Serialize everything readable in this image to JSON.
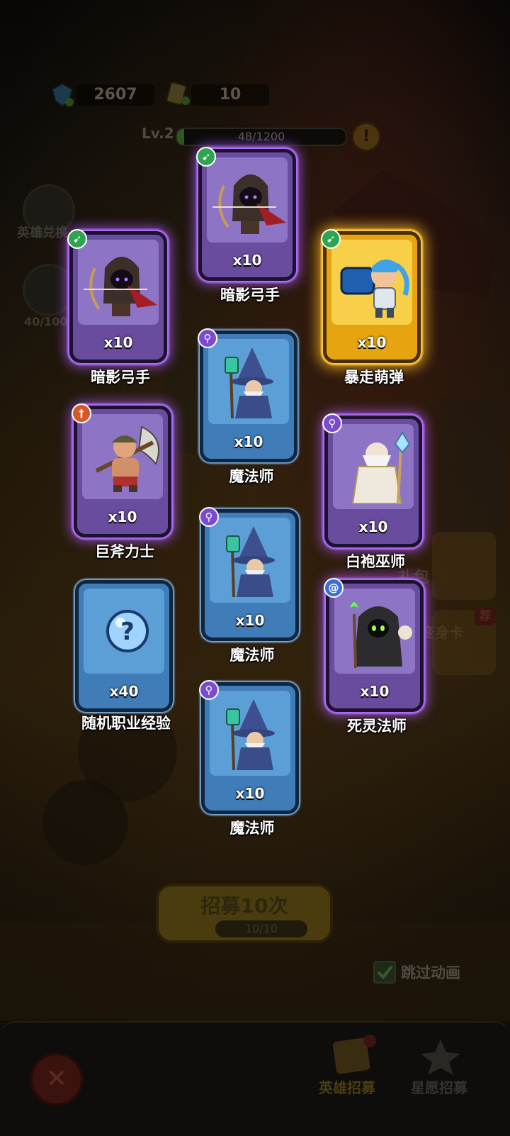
{
  "resources": {
    "gems": "2607",
    "tickets": "10"
  },
  "level": {
    "label": "Lv.2",
    "progress_text": "48/1200",
    "progress": 0.04,
    "warning_icon": "!"
  },
  "side": {
    "hero_exchange": "英雄兑换",
    "star_progress": "40/100"
  },
  "cards": [
    {
      "name": "暗影弓手",
      "count": "x10",
      "rarity": "purple",
      "class_icon": "bow-icon"
    },
    {
      "name": "暗影弓手",
      "count": "x10",
      "rarity": "purple",
      "class_icon": "bow-icon"
    },
    {
      "name": "暴走萌弹",
      "count": "x10",
      "rarity": "gold",
      "class_icon": "bow-icon"
    },
    {
      "name": "魔法师",
      "count": "x10",
      "rarity": "blue",
      "class_icon": "staff-icon"
    },
    {
      "name": "巨斧力士",
      "count": "x10",
      "rarity": "purple",
      "class_icon": "sword-icon"
    },
    {
      "name": "白袍巫师",
      "count": "x10",
      "rarity": "purple",
      "class_icon": "staff-icon"
    },
    {
      "name": "魔法师",
      "count": "x10",
      "rarity": "blue",
      "class_icon": "staff-icon"
    },
    {
      "name": "随机职业经验",
      "count": "x40",
      "rarity": "blue",
      "class_icon": ""
    },
    {
      "name": "死灵法师",
      "count": "x10",
      "rarity": "purple",
      "class_icon": "spiral-icon"
    },
    {
      "name": "魔法师",
      "count": "x10",
      "rarity": "blue",
      "class_icon": "staff-icon"
    }
  ],
  "recruit": {
    "label": "招募10次",
    "count": "10/10"
  },
  "skip": {
    "label": "跳过动画",
    "checked": true
  },
  "side_right": {
    "pack_label": "礼包",
    "card_label": "变身卡",
    "badge": "荐"
  },
  "nav": {
    "hero_recruit": "英雄招募",
    "star_recruit": "星愿招募",
    "close_glyph": "✕"
  },
  "colors": {
    "purple": "#6a4c9f",
    "gold": "#e6a510",
    "blue": "#3f7cb8"
  }
}
